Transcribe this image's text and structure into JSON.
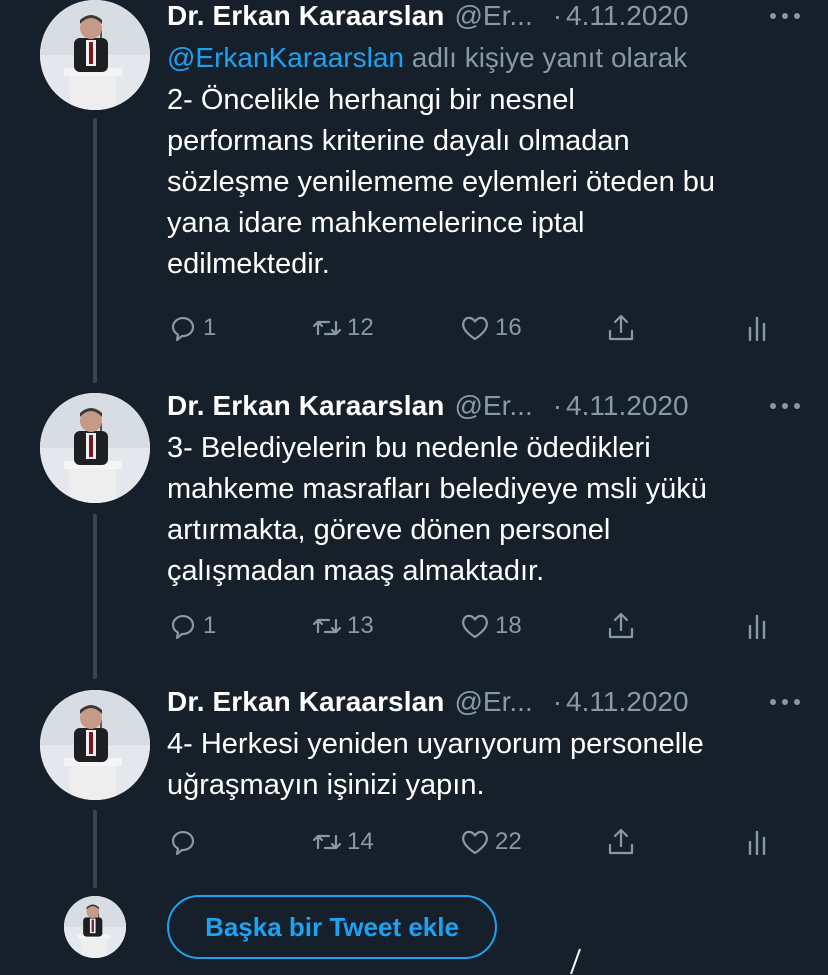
{
  "tweets": [
    {
      "author_name": "Dr. Erkan Karaarslan",
      "handle": "@Er...",
      "separator": "·",
      "date": "4.11.2020",
      "reply_mention": "@ErkanKaraarslan",
      "reply_suffix": "adlı kişiye yanıt olarak",
      "text": "2- Öncelikle herhangi bir nesnel\nperformans kriterine dayalı olmadan\nsözleşme yenilememe eylemleri öteden bu\nyana idare mahkemelerince iptal\nedilmektedir.",
      "replies": "1",
      "retweets": "12",
      "likes": "16"
    },
    {
      "author_name": "Dr. Erkan Karaarslan",
      "handle": "@Er...",
      "separator": "·",
      "date": "4.11.2020",
      "text": "3- Belediyelerin bu nedenle ödedikleri\nmahkeme masrafları belediyeye msli yükü\nartırmakta, göreve dönen personel\nçalışmadan maaş almaktadır.",
      "replies": "1",
      "retweets": "13",
      "likes": "18"
    },
    {
      "author_name": "Dr. Erkan Karaarslan",
      "handle": "@Er...",
      "separator": "·",
      "date": "4.11.2020",
      "text": "4- Herkesi yeniden uyarıyorum personelle\nuğraşmayın işinizi yapın.",
      "replies": "",
      "retweets": "14",
      "likes": "22"
    }
  ],
  "compose": {
    "add_tweet_label": "Başka bir Tweet ekle"
  },
  "icons": {
    "more": "more-horizontal-icon",
    "reply": "reply-icon",
    "retweet": "retweet-icon",
    "like": "heart-icon",
    "share": "share-icon",
    "analytics": "analytics-icon"
  },
  "colors": {
    "background": "#15202b",
    "accent": "#1da1f2",
    "secondary_text": "#8899a6",
    "thread_line": "#38444d"
  }
}
